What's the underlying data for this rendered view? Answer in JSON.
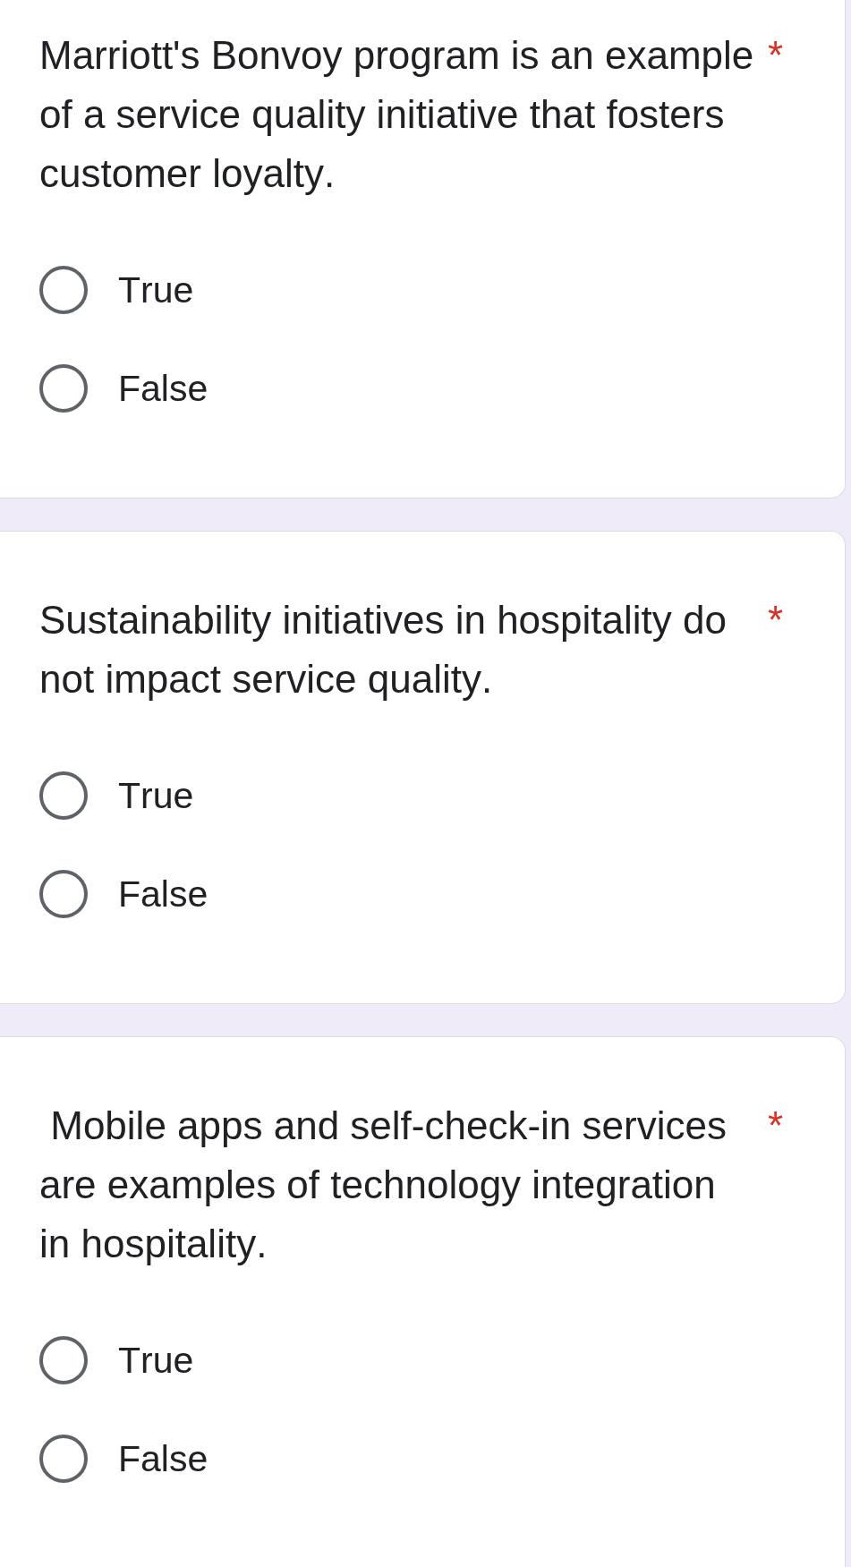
{
  "questions": [
    {
      "text": "Marriott's Bonvoy program is an example of a service quality initiative that fosters customer loyalty.",
      "required_mark": "*",
      "options": [
        {
          "label": "True",
          "selected": false
        },
        {
          "label": "False",
          "selected": false
        }
      ]
    },
    {
      "text": "Sustainability initiatives in hospitality do not impact service quality.",
      "required_mark": "*",
      "options": [
        {
          "label": "True",
          "selected": false
        },
        {
          "label": "False",
          "selected": false
        }
      ]
    },
    {
      "text": " Mobile apps and self-check-in services are examples of technology integration in hospitality.",
      "required_mark": "*",
      "options": [
        {
          "label": "True",
          "selected": false
        },
        {
          "label": "False",
          "selected": false
        }
      ]
    }
  ]
}
